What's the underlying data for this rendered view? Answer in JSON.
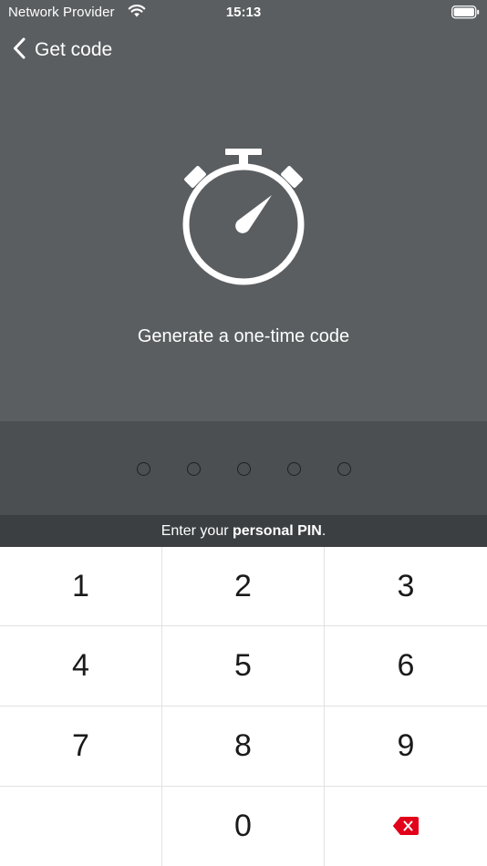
{
  "status_bar": {
    "carrier": "Network Provider",
    "time": "15:13"
  },
  "nav": {
    "back_title": "Get code"
  },
  "main": {
    "headline": "Generate a one-time code"
  },
  "pin": {
    "length": 5,
    "hint_prefix": "Enter your ",
    "hint_bold": "personal PIN",
    "hint_suffix": "."
  },
  "keypad": {
    "keys": [
      "1",
      "2",
      "3",
      "4",
      "5",
      "6",
      "7",
      "8",
      "9",
      "",
      "0",
      ""
    ]
  },
  "colors": {
    "header_bg": "#5a5e61",
    "pin_bg": "#4b4f52",
    "hint_bg": "#3b3f42",
    "delete_accent": "#e2001a"
  },
  "icons": {
    "back": "chevron-left-icon",
    "wifi": "wifi-icon",
    "battery": "battery-icon",
    "timer": "stopwatch-icon",
    "delete": "backspace-icon"
  }
}
